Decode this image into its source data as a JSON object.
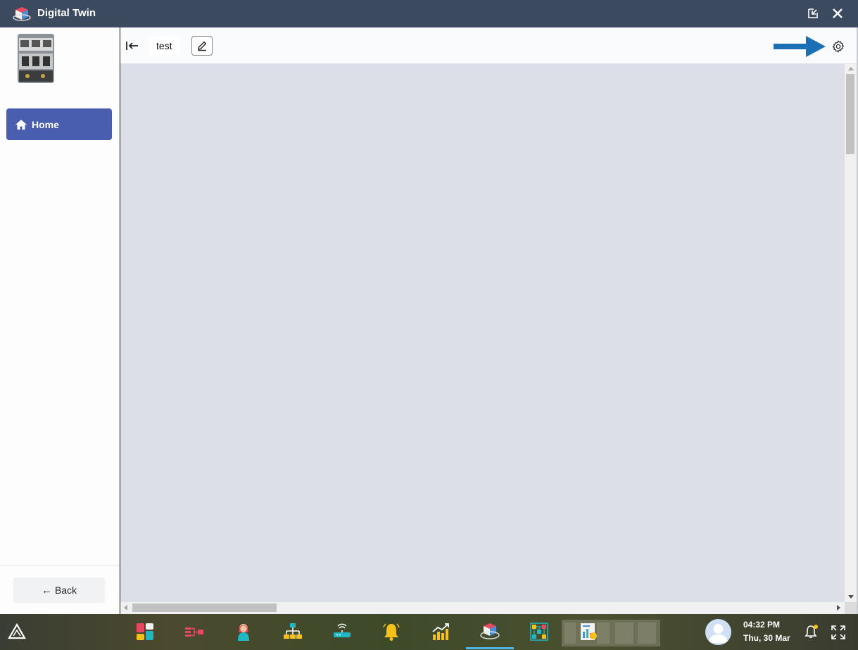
{
  "window": {
    "title": "Digital Twin",
    "icons": {
      "logo": "cube-logo-icon",
      "popout": "popout-icon",
      "close": "close-icon"
    }
  },
  "sidebar": {
    "thumbnail": "equipment-thumbnail",
    "nav": [
      {
        "label": "Home",
        "icon": "home-icon",
        "active": true
      }
    ],
    "back_label": "Back"
  },
  "toolbar": {
    "tab_label": "test",
    "icons": {
      "collapse": "collapse-left-icon",
      "edit": "pencil-icon",
      "settings": "gear-icon"
    }
  },
  "taskbar": {
    "apps": [
      "dashboard-icon",
      "flow-icon",
      "person-icon",
      "hierarchy-icon",
      "router-icon",
      "bell-alert-icon",
      "trend-chart-icon",
      "digital-twin-icon",
      "grid-nodes-icon",
      "report-icon"
    ],
    "active_app": "digital-twin-icon",
    "time": "04:32 PM",
    "date": "Thu, 30 Mar"
  },
  "colors": {
    "titlebar": "#3b4a5e",
    "accent": "#4a5eb0",
    "canvas": "#dcdfe7",
    "annotation_arrow": "#1a6fb5",
    "notification_dot": "#f5c21b"
  }
}
